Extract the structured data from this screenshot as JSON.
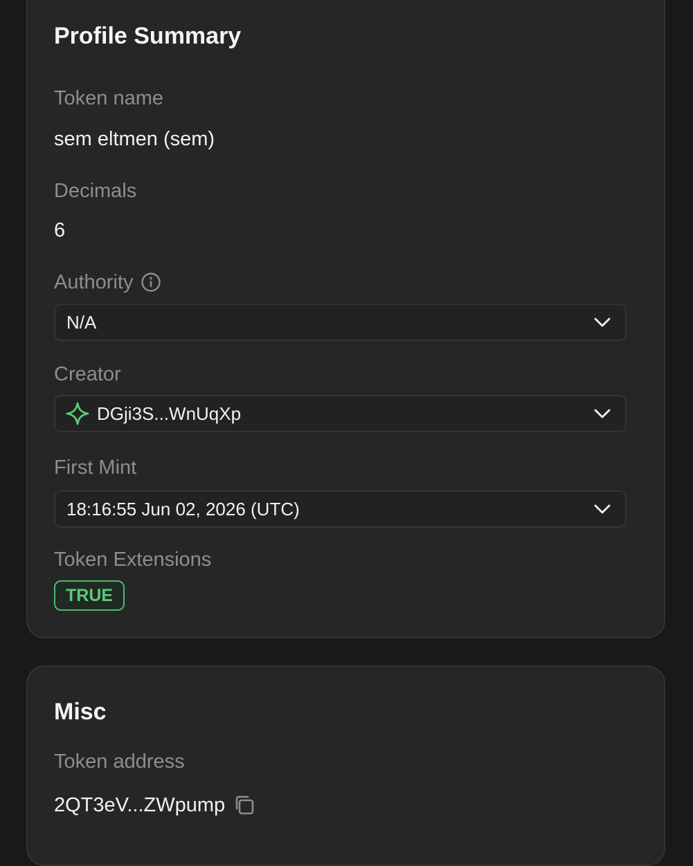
{
  "profile": {
    "title": "Profile Summary",
    "token_name_label": "Token name",
    "token_name_value": "sem eltmen (sem)",
    "decimals_label": "Decimals",
    "decimals_value": "6",
    "authority_label": "Authority",
    "authority_value": "N/A",
    "creator_label": "Creator",
    "creator_value": "DGji3S...WnUqXp",
    "first_mint_label": "First Mint",
    "first_mint_value": "18:16:55 Jun 02, 2026 (UTC)",
    "token_extensions_label": "Token Extensions",
    "token_extensions_value": "TRUE"
  },
  "misc": {
    "title": "Misc",
    "token_address_label": "Token address",
    "token_address_value": "2QT3eV...ZWpump"
  },
  "colors": {
    "background": "#191919",
    "card": "#262626",
    "accent_green": "#5fc97a",
    "muted_text": "#8e8e8e"
  },
  "icons": {
    "info": "info-circle-icon",
    "chevron": "chevron-down-icon",
    "creator": "sparkle-icon",
    "copy": "copy-icon"
  }
}
